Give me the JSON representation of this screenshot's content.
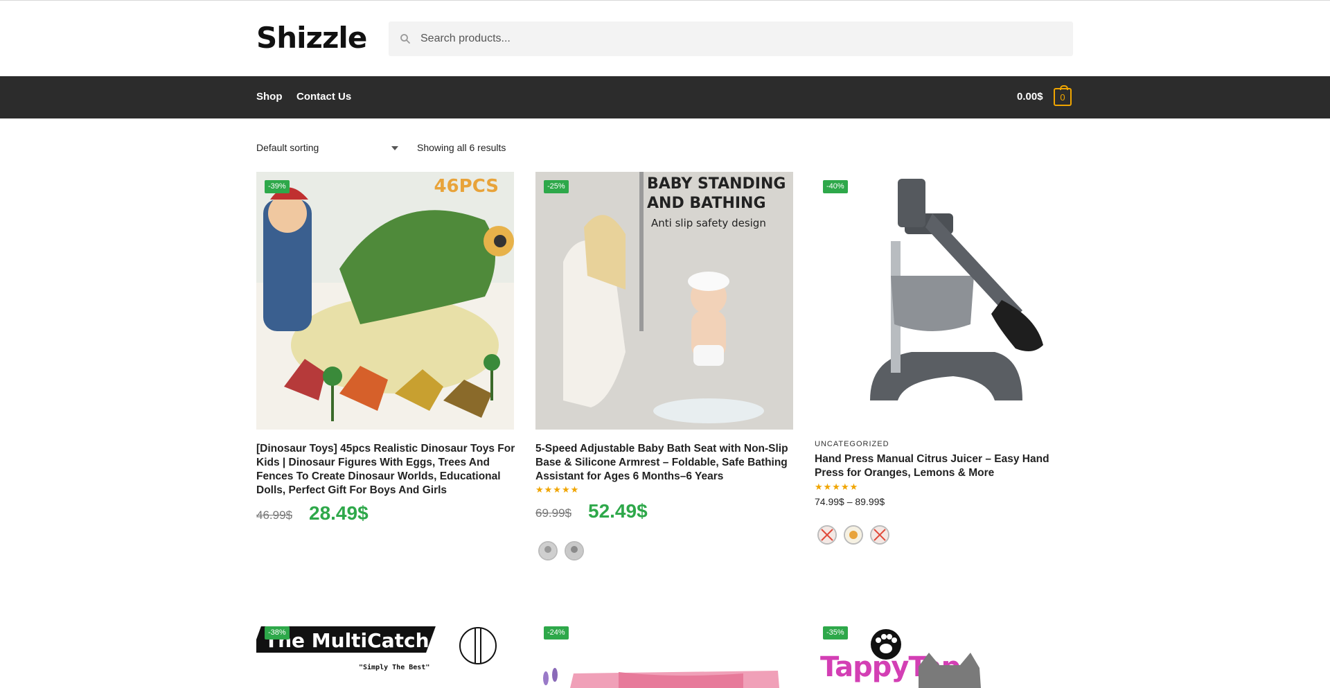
{
  "header": {
    "logo": "Shizzle",
    "search_placeholder": "Search products..."
  },
  "nav": {
    "items": [
      "Shop",
      "Contact Us"
    ],
    "cart_total": "0.00$",
    "cart_count": "0"
  },
  "toolbar": {
    "sorting": "Default sorting",
    "results": "Showing all 6 results"
  },
  "products": [
    {
      "badge": "-39%",
      "title": "[Dinosaur Toys] 45pcs Realistic Dinosaur Toys For Kids | Dinosaur Figures With Eggs, Trees And Fences To Create Dinosaur Worlds, Educational Dolls, Perfect Gift For Boys And Girls",
      "old_price": "46.99$",
      "price": "28.49$",
      "image_text": "46PCS"
    },
    {
      "badge": "-25%",
      "title": "5-Speed Adjustable Baby Bath Seat with Non-Slip Base & Silicone Armrest – Foldable, Safe Bathing Assistant for Ages 6 Months–6 Years",
      "old_price": "69.99$",
      "price": "52.49$",
      "rating": 5,
      "image_text_1": "BABY STANDING",
      "image_text_2": "AND BATHING",
      "image_text_3": "Anti slip safety design"
    },
    {
      "badge": "-40%",
      "category": "UNCATEGORIZED",
      "title": "Hand Press Manual Citrus Juicer – Easy Hand Press for Oranges, Lemons & More",
      "price_range": "74.99$ – 89.99$",
      "rating": 5
    },
    {
      "badge": "-38%",
      "image_text_1": "The MultiCatch",
      "image_text_2": "\"Simply The Best\""
    },
    {
      "badge": "-24%"
    },
    {
      "badge": "-35%",
      "image_text": "TappyTap"
    }
  ],
  "colors": {
    "accent_green": "#2ea84a",
    "star": "#f0a500",
    "navbar": "#2c2c2c"
  }
}
